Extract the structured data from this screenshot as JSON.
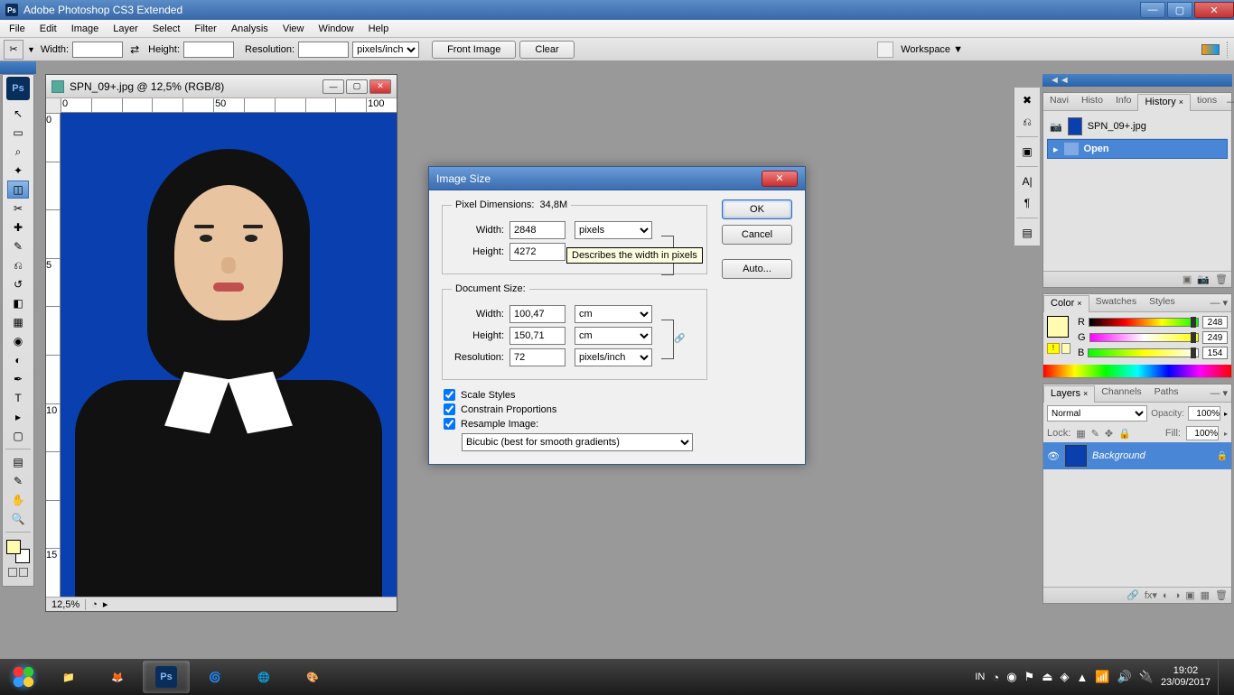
{
  "app_title": "Adobe Photoshop CS3 Extended",
  "menu": [
    "File",
    "Edit",
    "Image",
    "Layer",
    "Select",
    "Filter",
    "Analysis",
    "View",
    "Window",
    "Help"
  ],
  "options": {
    "width_label": "Width:",
    "height_label": "Height:",
    "resolution_label": "Resolution:",
    "res_unit": "pixels/inch",
    "front_image_btn": "Front Image",
    "clear_btn": "Clear",
    "workspace_label": "Workspace ▼"
  },
  "document": {
    "title": "SPN_09+.jpg @ 12,5% (RGB/8)",
    "zoom": "12,5%",
    "hruler_ticks": [
      "0",
      "",
      "",
      "50",
      "",
      "",
      "",
      "",
      "",
      "",
      "100"
    ],
    "vruler_ticks": [
      "0",
      "",
      "",
      "5",
      "",
      "",
      "10",
      "",
      "",
      "15"
    ]
  },
  "dialog": {
    "title": "Image Size",
    "pixeldim_label": "Pixel Dimensions:",
    "pixeldim_value": "34,8M",
    "px_width_lbl": "Width:",
    "px_width_val": "2848",
    "px_height_lbl": "Height:",
    "px_height_val": "4272",
    "px_unit": "pixels",
    "tooltip": "Describes the width in pixels",
    "docsize_label": "Document Size:",
    "doc_width_lbl": "Width:",
    "doc_width_val": "100,47",
    "doc_height_lbl": "Height:",
    "doc_height_val": "150,71",
    "doc_unit": "cm",
    "doc_res_lbl": "Resolution:",
    "doc_res_val": "72",
    "doc_res_unit": "pixels/inch",
    "chk_scale": "Scale Styles",
    "chk_constrain": "Constrain Proportions",
    "chk_resample": "Resample Image:",
    "resample_opt": "Bicubic (best for smooth gradients)",
    "ok": "OK",
    "cancel": "Cancel",
    "auto": "Auto..."
  },
  "history": {
    "tabs": [
      "Navi",
      "Histo",
      "Info",
      "History",
      "tions"
    ],
    "file": "SPN_09+.jpg",
    "item": "Open"
  },
  "color": {
    "tabs": [
      "Color",
      "Swatches",
      "Styles"
    ],
    "r_lbl": "R",
    "r_val": "248",
    "g_lbl": "G",
    "g_val": "249",
    "b_lbl": "B",
    "b_val": "154"
  },
  "layers": {
    "tabs": [
      "Layers",
      "Channels",
      "Paths"
    ],
    "blend": "Normal",
    "opacity_lbl": "Opacity:",
    "opacity_val": "100%",
    "lock_lbl": "Lock:",
    "fill_lbl": "Fill:",
    "fill_val": "100%",
    "layer_name": "Background"
  },
  "taskbar": {
    "lang": "IN",
    "time": "19:02",
    "date": "23/09/2017"
  }
}
